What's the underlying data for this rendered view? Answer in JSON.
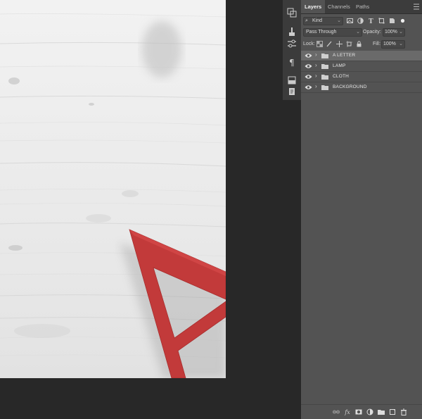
{
  "panel": {
    "tabs": [
      {
        "label": "Layers",
        "active": true
      },
      {
        "label": "Channels",
        "active": false
      },
      {
        "label": "Paths",
        "active": false
      }
    ],
    "filter": {
      "kind": "Kind"
    },
    "blend": {
      "mode": "Pass Through",
      "opacity_label": "Opacity:",
      "opacity_value": "100%"
    },
    "lock": {
      "label": "Lock:",
      "fill_label": "Fill:",
      "fill_value": "100%"
    },
    "layers": [
      {
        "name": "A LETTER",
        "type": "group",
        "visible": true,
        "selected": true
      },
      {
        "name": "LAMP",
        "type": "group",
        "visible": true,
        "selected": false
      },
      {
        "name": "CLOTH",
        "type": "group",
        "visible": true,
        "selected": false
      },
      {
        "name": "BACKGROUND",
        "type": "group",
        "visible": true,
        "selected": false
      }
    ]
  },
  "toolstrip": {
    "icons": [
      "history-icon",
      "brush-presets-icon",
      "properties-icon",
      "paragraph-icon",
      "swatches-icon",
      "notes-icon"
    ]
  },
  "colors": {
    "panel_bg": "#535353",
    "workspace_bg": "#282828",
    "selected_row": "#6a6a6a",
    "letter_red": "#c23a3a"
  }
}
